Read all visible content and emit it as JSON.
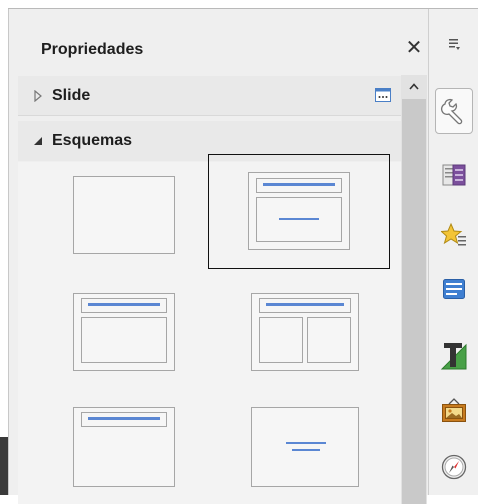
{
  "deck": {
    "title": "Propriedades",
    "close_glyph": "✕"
  },
  "panels": {
    "slide": {
      "label": "Slide",
      "expanded": false,
      "more_options_icon": "more-options-icon"
    },
    "esquemas": {
      "label": "Esquemas",
      "expanded": true
    }
  },
  "layouts": [
    {
      "name": "blank",
      "selected": false
    },
    {
      "name": "title-content",
      "selected": true
    },
    {
      "name": "title-content-frame",
      "selected": false
    },
    {
      "name": "title-two-columns",
      "selected": false
    },
    {
      "name": "title-only",
      "selected": false
    },
    {
      "name": "centered-text",
      "selected": false
    }
  ],
  "sidebar_tabs": [
    {
      "icon": "properties-wrench-icon",
      "active": true
    },
    {
      "icon": "master-slides-icon",
      "active": false
    },
    {
      "icon": "animation-star-icon",
      "active": false
    },
    {
      "icon": "slide-transition-icon",
      "active": false
    },
    {
      "icon": "styles-fontwork-icon",
      "active": false
    },
    {
      "icon": "gallery-image-icon",
      "active": false
    },
    {
      "icon": "navigator-compass-icon",
      "active": false
    }
  ],
  "colors": {
    "accent_bar": "#5b87d3",
    "thumb_border": "#a6a6a6",
    "selected_border": "#111111"
  }
}
